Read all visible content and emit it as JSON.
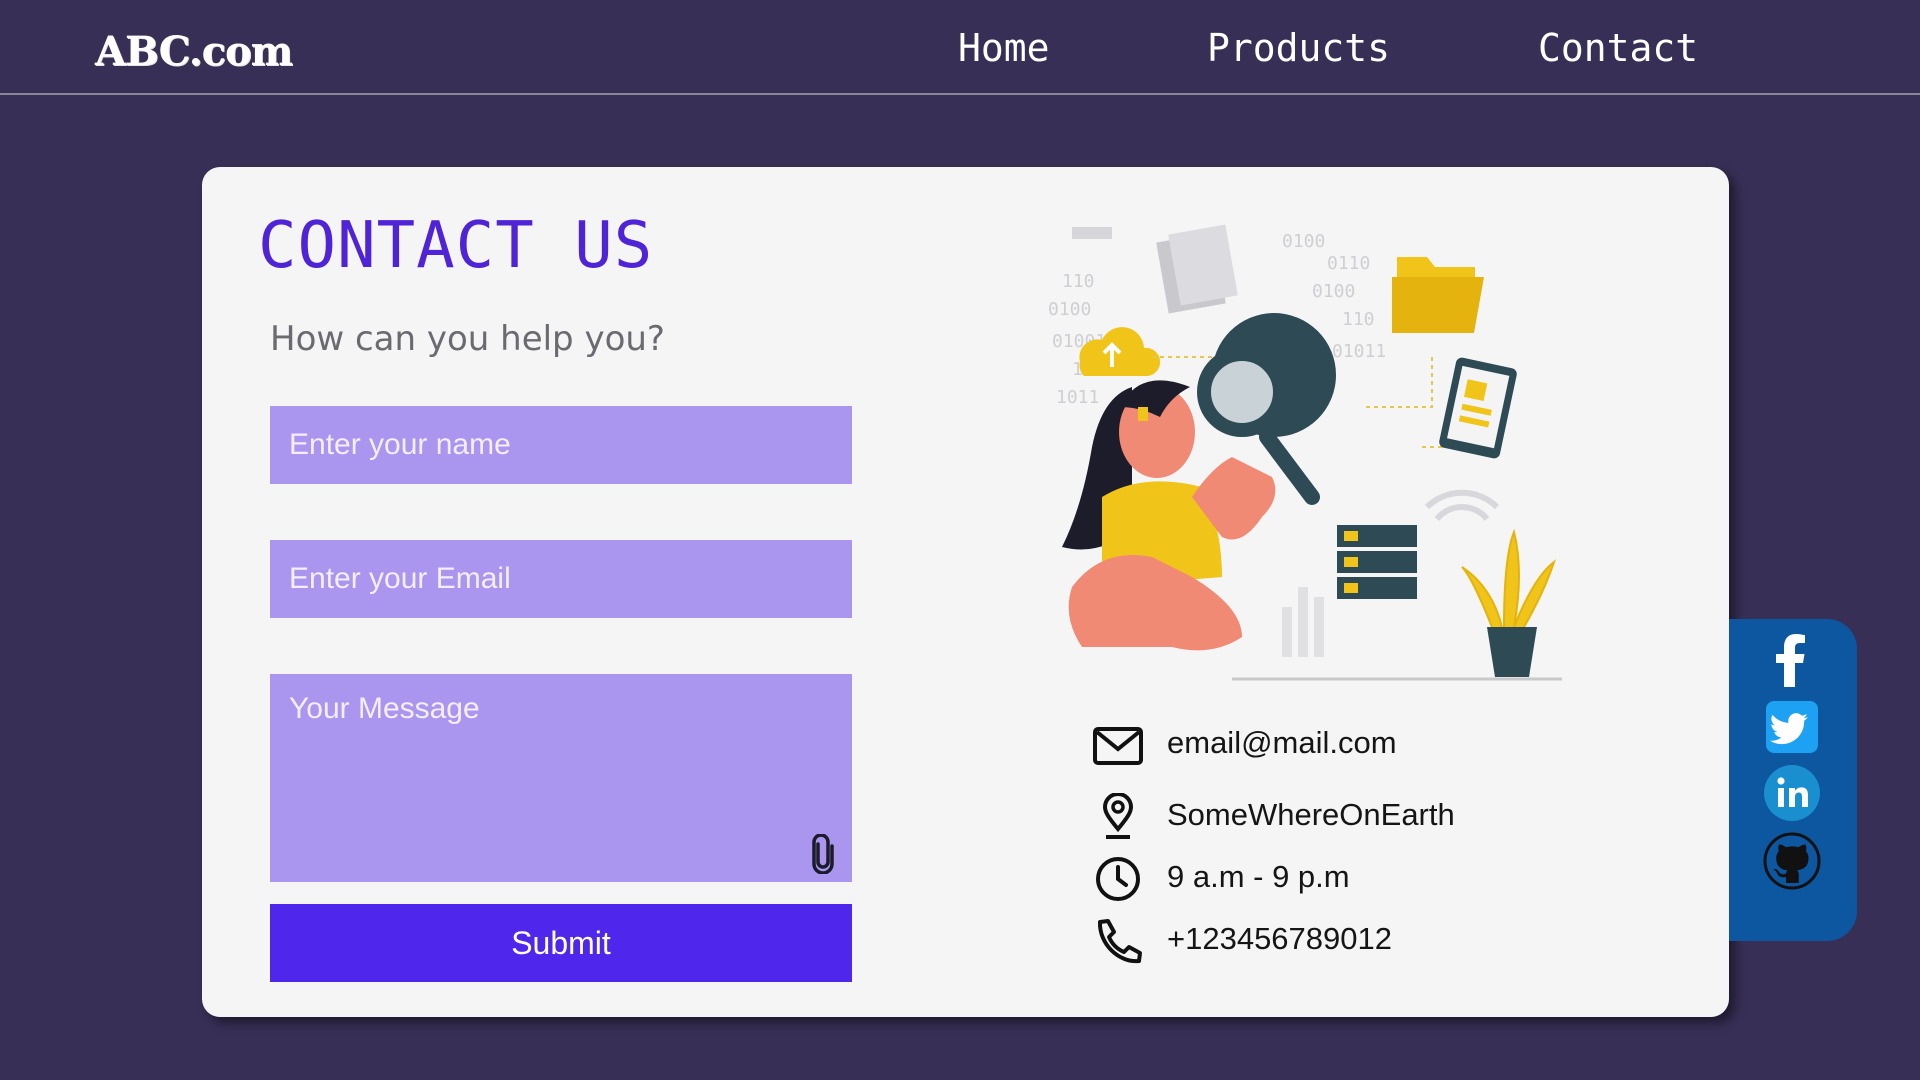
{
  "header": {
    "logo": "ABC.com",
    "nav": [
      "Home",
      "Products",
      "Contact"
    ]
  },
  "contact": {
    "title": "CONTACT US",
    "subtitle": "How can you help you?",
    "name_placeholder": "Enter your name",
    "email_placeholder": "Enter your Email",
    "message_placeholder": "Your Message",
    "submit_label": "Submit"
  },
  "info": {
    "email": "email@mail.com",
    "location": "SomeWhereOnEarth",
    "hours": "9 a.m - 9 p.m",
    "phone": "+123456789012"
  },
  "social": [
    "facebook-icon",
    "twitter-icon",
    "linkedin-icon",
    "github-icon"
  ],
  "colors": {
    "background": "#372f55",
    "card": "#f5f5f5",
    "accent_title": "#4f24d6",
    "field": "#aa95ef",
    "submit": "#4e26ec",
    "social_bar": "#0d56a0"
  }
}
